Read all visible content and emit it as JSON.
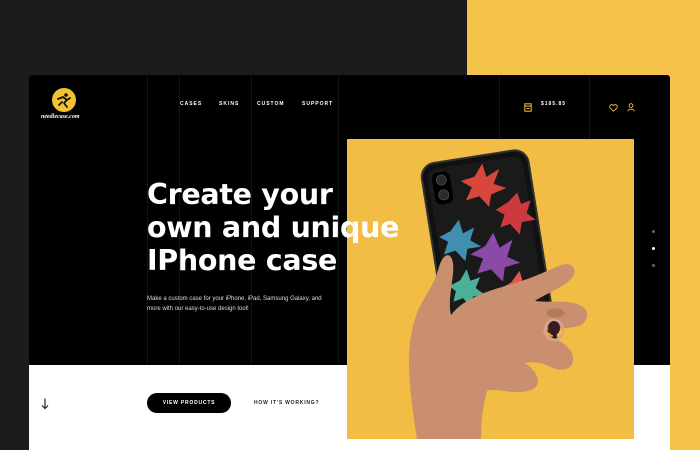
{
  "brand": {
    "name": "needlecase.com",
    "accent": "#f5c332"
  },
  "nav": {
    "items": [
      "CASES",
      "SKINS",
      "CUSTOM",
      "SUPPORT"
    ]
  },
  "header": {
    "cart_total": "$185.85",
    "icons": [
      "cart-icon",
      "heart-icon",
      "user-icon"
    ]
  },
  "hero": {
    "title_lines": [
      "Create your",
      "own and unique",
      "IPhone case"
    ],
    "description": "Make a custom case for your iPhone, iPad, Samsung Galaxy, and more with our easy-to-use design tool!",
    "primary_button": "VIEW PRODUCTS",
    "secondary_link": "HOW IT'S WORKING?"
  },
  "slider": {
    "dots": 3,
    "active_index": 1
  },
  "colors": {
    "page_bg": "#1c1c1c",
    "yellow": "#f4c14a",
    "card_bg": "#000000",
    "bottom_bg": "#ffffff"
  }
}
